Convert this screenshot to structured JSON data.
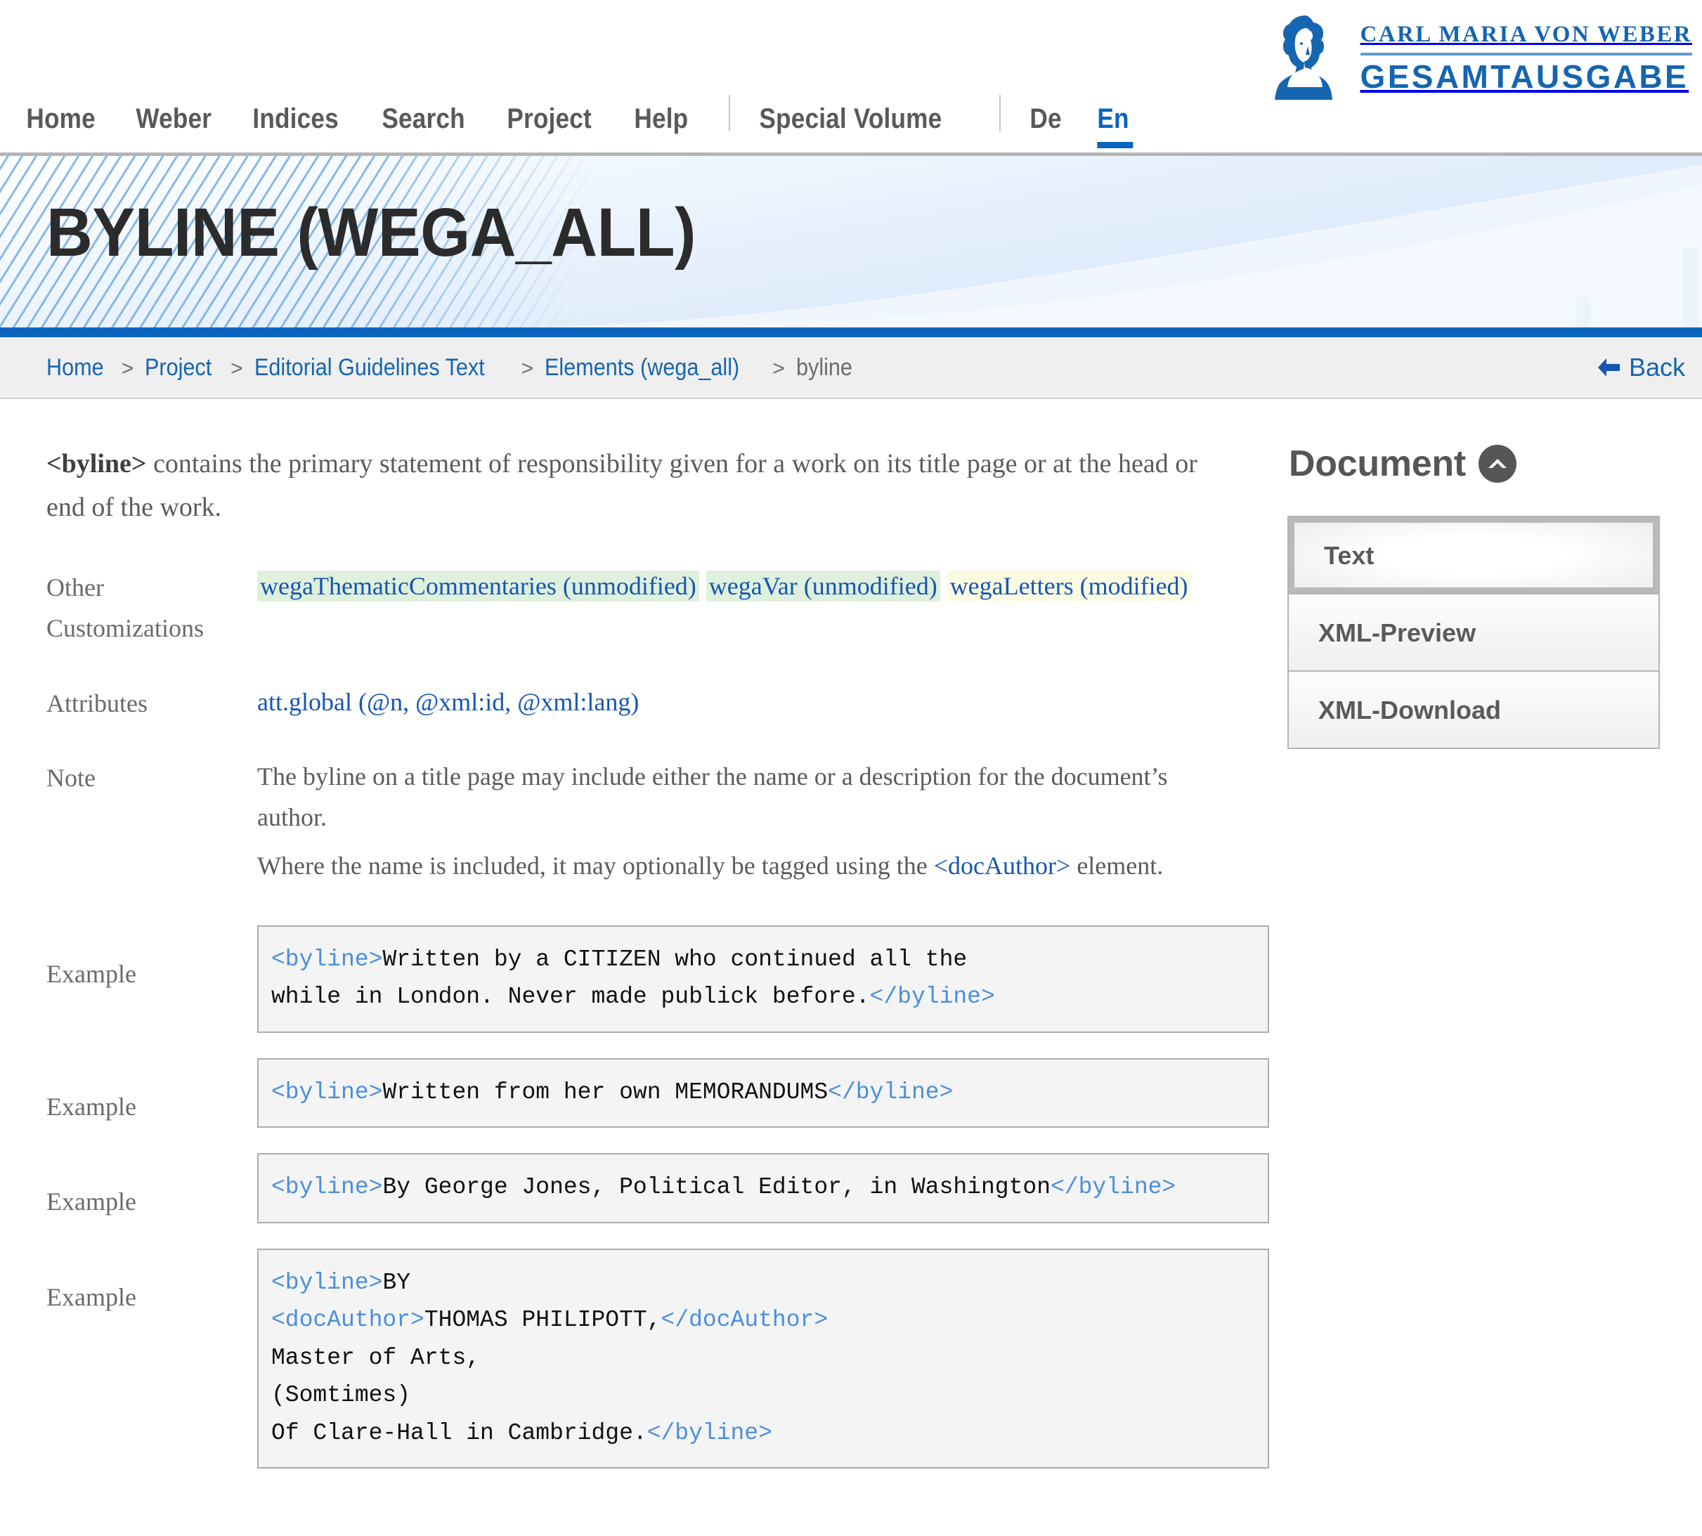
{
  "header": {
    "nav": [
      {
        "label": "Home",
        "type": "link"
      },
      {
        "label": "Weber",
        "type": "link"
      },
      {
        "label": "Indices",
        "type": "link"
      },
      {
        "label": "Search",
        "type": "link"
      },
      {
        "label": "Project",
        "type": "link"
      },
      {
        "label": "Help",
        "type": "link"
      },
      {
        "label": "Special Volume",
        "type": "link"
      },
      {
        "label": "De",
        "type": "lang"
      },
      {
        "label": "En",
        "type": "lang-active"
      }
    ],
    "logo": {
      "line1": "CARL MARIA VON WEBER",
      "line2": "GESAMTAUSGABE",
      "portrait_alt": "weber-portrait-icon"
    }
  },
  "banner": {
    "title": "BYLINE (WEGA_ALL)",
    "accent_color": "#0a64be"
  },
  "breadcrumb": {
    "items": [
      "Home",
      "Project",
      "Editorial Guidelines Text",
      "Elements (wega_all)",
      "byline"
    ],
    "separator": ">",
    "back_label": "Back"
  },
  "main": {
    "intro": {
      "tag": "<byline>",
      "text": " contains the primary statement of responsibility given for a work on its title page or at the head or end of the work."
    },
    "rows": [
      {
        "label": "Other Customizations",
        "type": "chips",
        "chips": [
          {
            "text": "wegaThematicCommentaries (unmodified)",
            "state": "unmodified"
          },
          {
            "text": "wegaVar (unmodified)",
            "state": "unmodified"
          },
          {
            "text": "wegaLetters (modified)",
            "state": "modified"
          }
        ]
      },
      {
        "label": "Attributes",
        "type": "link",
        "link": "att.global (@n, @xml:id, @xml:lang)"
      },
      {
        "label": "Note",
        "type": "note",
        "note_line1": "The byline on a title page may include either the name or a description for the document’s author.",
        "note_line2_pre": "Where the name is included, it may optionally be tagged using the ",
        "note_line2_tag": "<docAuthor>",
        "note_line2_post": " element."
      }
    ],
    "examples": [
      {
        "label": "Example",
        "lines": [
          [
            {
              "t": "tag",
              "v": "<byline>"
            },
            {
              "t": "txt",
              "v": "Written by a CITIZEN who continued all the"
            }
          ],
          [
            {
              "t": "txt",
              "v": "while in London. Never made publick before."
            },
            {
              "t": "tag",
              "v": "</byline>"
            }
          ]
        ]
      },
      {
        "label": "Example",
        "lines": [
          [
            {
              "t": "tag",
              "v": "<byline>"
            },
            {
              "t": "txt",
              "v": "Written from her own MEMORANDUMS"
            },
            {
              "t": "tag",
              "v": "</byline>"
            }
          ]
        ]
      },
      {
        "label": "Example",
        "lines": [
          [
            {
              "t": "tag",
              "v": "<byline>"
            },
            {
              "t": "txt",
              "v": "By George Jones, Political Editor, in Washington"
            },
            {
              "t": "tag",
              "v": "</byline>"
            }
          ]
        ]
      },
      {
        "label": "Example",
        "lines": [
          [
            {
              "t": "tag",
              "v": "<byline>"
            },
            {
              "t": "txt",
              "v": "BY"
            }
          ],
          [
            {
              "t": "tag",
              "v": "<docAuthor>"
            },
            {
              "t": "txt",
              "v": "THOMAS PHILIPOTT,"
            },
            {
              "t": "tag",
              "v": "</docAuthor>"
            }
          ],
          [
            {
              "t": "txt",
              "v": "Master of Arts,"
            }
          ],
          [
            {
              "t": "txt",
              "v": "(Somtimes)"
            }
          ],
          [
            {
              "t": "txt",
              "v": "Of Clare-Hall in Cambridge."
            },
            {
              "t": "tag",
              "v": "</byline>"
            }
          ]
        ]
      }
    ]
  },
  "sidebar": {
    "title": "Document",
    "collapse_icon": "chevron-up-circle-icon",
    "items": [
      {
        "label": "Text",
        "selected": true
      },
      {
        "label": "XML-Preview",
        "selected": false
      },
      {
        "label": "XML-Download",
        "selected": false
      }
    ]
  }
}
